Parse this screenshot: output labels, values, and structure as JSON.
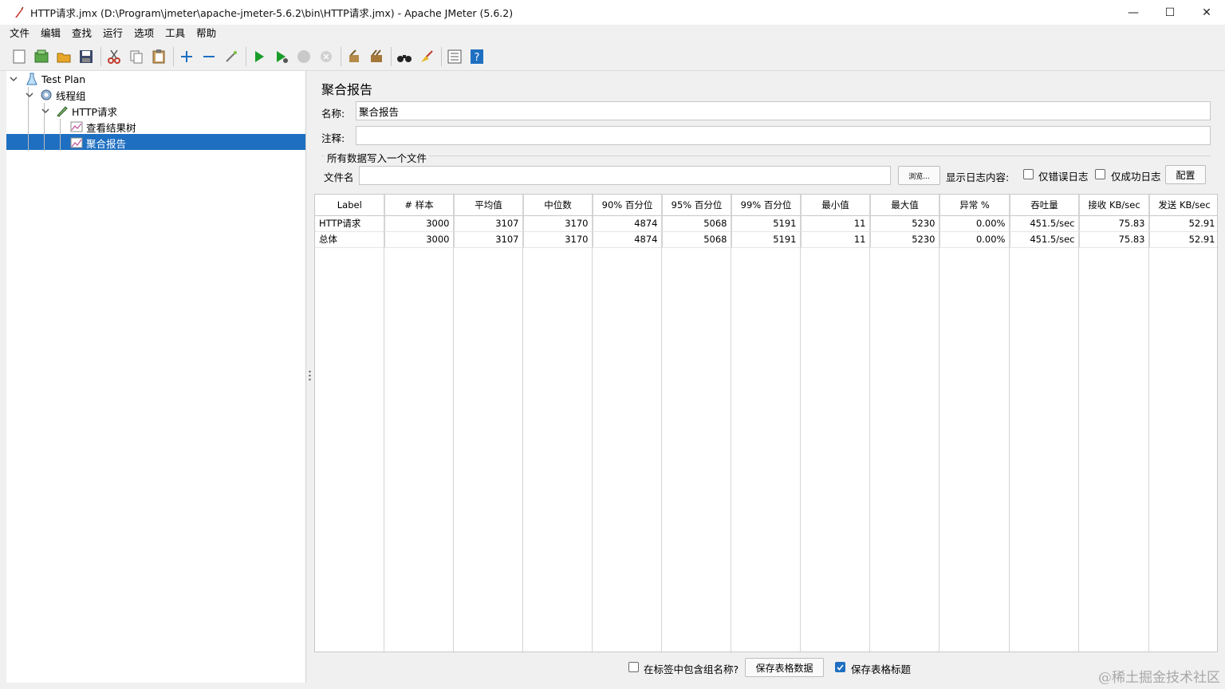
{
  "window": {
    "title": "HTTP请求.jmx (D:\\Program\\jmeter\\apache-jmeter-5.6.2\\bin\\HTTP请求.jmx) - Apache JMeter (5.6.2)",
    "minimize": "—",
    "maximize": "☐",
    "close": "✕"
  },
  "menu": [
    "文件",
    "编辑",
    "查找",
    "运行",
    "选项",
    "工具",
    "帮助"
  ],
  "tree": {
    "items": [
      {
        "label": "Test Plan",
        "icon": "test-plan-icon"
      },
      {
        "label": "线程组",
        "icon": "thread-group-gear-icon"
      },
      {
        "label": "HTTP请求",
        "icon": "http-sampler-icon"
      },
      {
        "label": "查看结果树",
        "icon": "listener-graph-icon"
      },
      {
        "label": "聚合报告",
        "icon": "listener-graph-icon"
      }
    ]
  },
  "panel": {
    "title": "聚合报告",
    "name_label": "名称:",
    "name_value": "聚合报告",
    "comment_label": "注释:",
    "comment_value": "",
    "file_group_title": "所有数据写入一个文件",
    "filename_label": "文件名",
    "filename_value": "",
    "browse_label": "浏览...",
    "log_content_label": "显示日志内容:",
    "errors_only_label": "仅错误日志",
    "success_only_label": "仅成功日志",
    "configure_label": "配置"
  },
  "table": {
    "headers": [
      "Label",
      "# 样本",
      "平均值",
      "中位数",
      "90% 百分位",
      "95% 百分位",
      "99% 百分位",
      "最小值",
      "最大值",
      "异常 %",
      "吞吐量",
      "接收 KB/sec",
      "发送 KB/sec"
    ],
    "rows": [
      [
        "HTTP请求",
        "3000",
        "3107",
        "3170",
        "4874",
        "5068",
        "5191",
        "11",
        "5230",
        "0.00%",
        "451.5/sec",
        "75.83",
        "52.91"
      ],
      [
        "总体",
        "3000",
        "3107",
        "3170",
        "4874",
        "5068",
        "5191",
        "11",
        "5230",
        "0.00%",
        "451.5/sec",
        "75.83",
        "52.91"
      ]
    ]
  },
  "bottom": {
    "include_group_label": "在标签中包含组名称?",
    "save_table_data_label": "保存表格数据",
    "save_table_header_label": "保存表格标题",
    "save_table_header_checked": true
  },
  "watermark": "@稀土掘金技术社区",
  "colors": {
    "selection": "#1e6fc1",
    "run_green": "#1a9c2a"
  }
}
